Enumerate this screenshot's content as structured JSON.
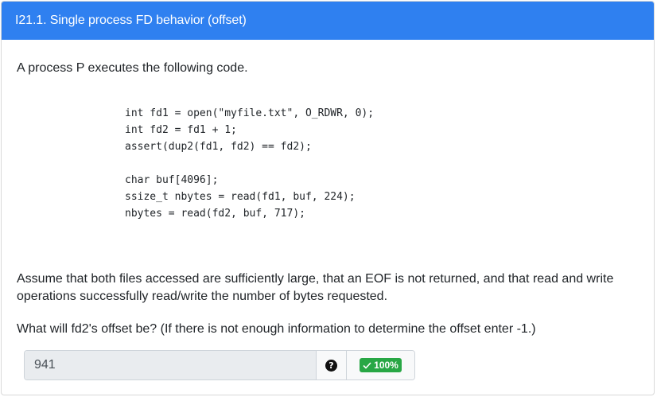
{
  "header": {
    "title": "I21.1. Single process FD behavior (offset)"
  },
  "body": {
    "intro": "A process P executes the following code.",
    "code": "int fd1 = open(\"myfile.txt\", O_RDWR, 0);\nint fd2 = fd1 + 1;\nassert(dup2(fd1, fd2) == fd2);\n\nchar buf[4096];\nssize_t nbytes = read(fd1, buf, 224);\nnbytes = read(fd2, buf, 717);",
    "assumption": "Assume that both files accessed are sufficiently large, that an EOF is not returned, and that read and write operations successfully read/write the number of bytes requested.",
    "question": "What will fd2's offset be? (If there is not enough information to determine the offset enter -1.)"
  },
  "answer": {
    "value": "941",
    "help_icon": "question-circle-icon",
    "score_icon": "check-icon",
    "score_label": "100%"
  },
  "colors": {
    "header_bg": "#2f80f0",
    "badge_bg": "#28a745",
    "input_bg": "#e9ecef"
  }
}
